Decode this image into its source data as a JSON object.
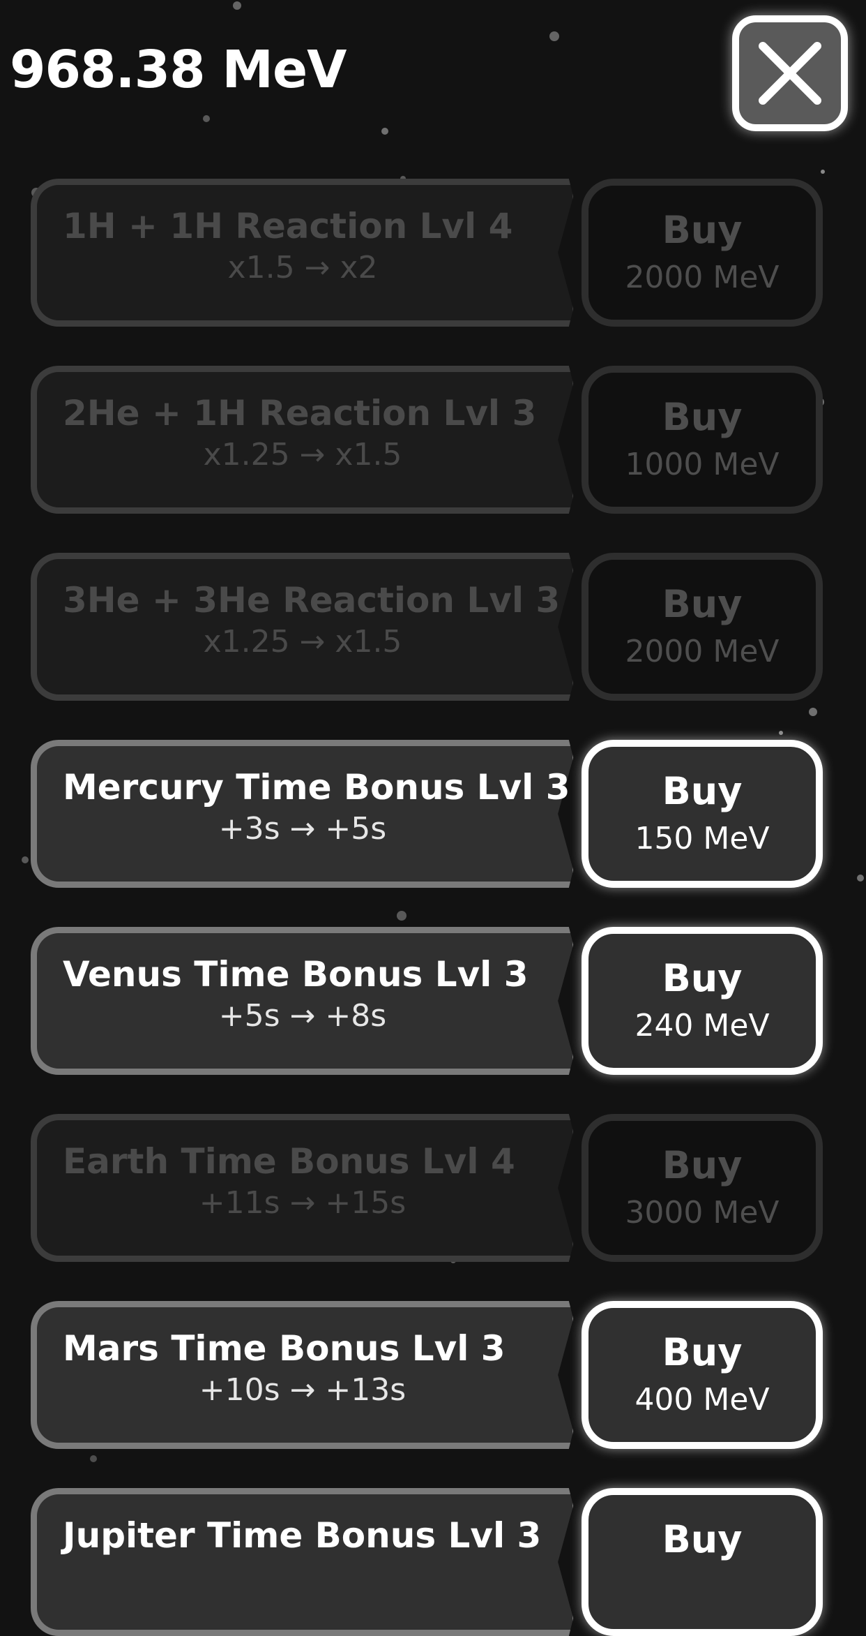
{
  "header": {
    "balance": "968.38 MeV",
    "close_icon": "close-x-icon"
  },
  "colors": {
    "background": "#121212",
    "card_enabled": "#303030",
    "card_locked": "#1c1c1c",
    "button_border_enabled": "#ffffff",
    "text_locked": "#4a4a4a"
  },
  "upgrades": [
    {
      "title": "1H + 1H Reaction Lvl 4",
      "effect": "x1.5 → x2",
      "buy_label": "Buy",
      "price": "2000 MeV",
      "affordable": false
    },
    {
      "title": "2He + 1H Reaction Lvl 3",
      "effect": "x1.25 → x1.5",
      "buy_label": "Buy",
      "price": "1000 MeV",
      "affordable": false
    },
    {
      "title": "3He + 3He Reaction Lvl 3",
      "effect": "x1.25 → x1.5",
      "buy_label": "Buy",
      "price": "2000 MeV",
      "affordable": false
    },
    {
      "title": "Mercury Time Bonus Lvl 3",
      "effect": "+3s → +5s",
      "buy_label": "Buy",
      "price": "150 MeV",
      "affordable": true
    },
    {
      "title": "Venus Time Bonus Lvl 3",
      "effect": "+5s → +8s",
      "buy_label": "Buy",
      "price": "240 MeV",
      "affordable": true
    },
    {
      "title": "Earth Time Bonus Lvl 4",
      "effect": "+11s → +15s",
      "buy_label": "Buy",
      "price": "3000 MeV",
      "affordable": false
    },
    {
      "title": "Mars Time Bonus Lvl 3",
      "effect": "+10s → +13s",
      "buy_label": "Buy",
      "price": "400 MeV",
      "affordable": true
    },
    {
      "title": "Jupiter Time Bonus Lvl 3",
      "effect": "",
      "buy_label": "Buy",
      "price": "",
      "affordable": true
    }
  ]
}
